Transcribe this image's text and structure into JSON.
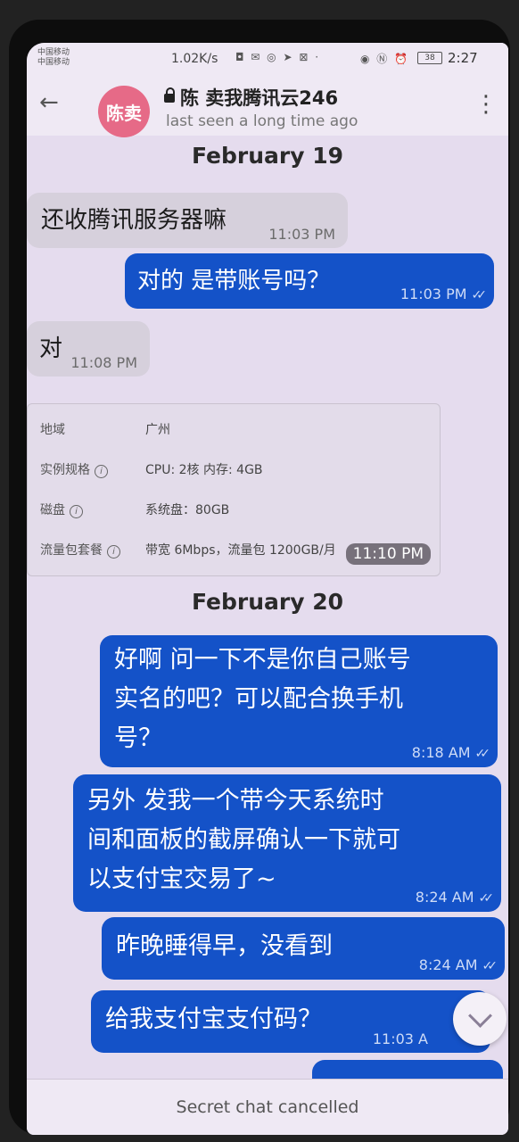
{
  "status_bar": {
    "carrier_1": "中国移动",
    "carrier_2": "中国移动",
    "network_speed": "1.02K/s",
    "app_icons": "◘ ✉ ◎ ➤ ⊠ ·",
    "right_icons": "◉ Ⓝ ⏰",
    "battery": "38",
    "time": "2:27"
  },
  "header": {
    "avatar_text": "陈卖",
    "title": "陈 卖我腾讯云246",
    "subtitle": "last seen a long time ago"
  },
  "chat": {
    "date_1": "February 19",
    "msg1": {
      "text": "还收腾讯服务器嘛",
      "time": "11:03 PM"
    },
    "msg2": {
      "text": "对的 是带账号吗？",
      "time": "11:03 PM"
    },
    "msg3": {
      "text": "对",
      "time": "11:08 PM"
    },
    "image_msg": {
      "rows": [
        {
          "label": "地域",
          "value": "广州"
        },
        {
          "label": "实例规格",
          "value": "CPU: 2核 内存: 4GB"
        },
        {
          "label": "磁盘",
          "value": "系统盘：80GB"
        },
        {
          "label": "流量包套餐",
          "value": "带宽 6Mbps，流量包 1200GB/月"
        }
      ],
      "time": "11:10 PM"
    },
    "date_2": "February 20",
    "msg4": {
      "text": "好啊 问一下不是你自己账号\n实名的吧？可以配合换手机\n号？",
      "time": "8:18 AM"
    },
    "msg5": {
      "text": "另外 发我一个带今天系统时\n间和面板的截屏确认一下就可\n以支付宝交易了~",
      "time": "8:24 AM"
    },
    "msg6": {
      "text": "昨晚睡得早，没看到",
      "time": "8:24 AM"
    },
    "msg7": {
      "text": "给我支付宝支付码？",
      "time": "11:03 A"
    }
  },
  "bottom_bar": {
    "text": "Secret chat cancelled"
  },
  "colors": {
    "outgoing_bubble": "#1452c8",
    "incoming_bubble": "#d6d0dc",
    "chat_background": "#e5dcee",
    "avatar": "#e66a87"
  }
}
